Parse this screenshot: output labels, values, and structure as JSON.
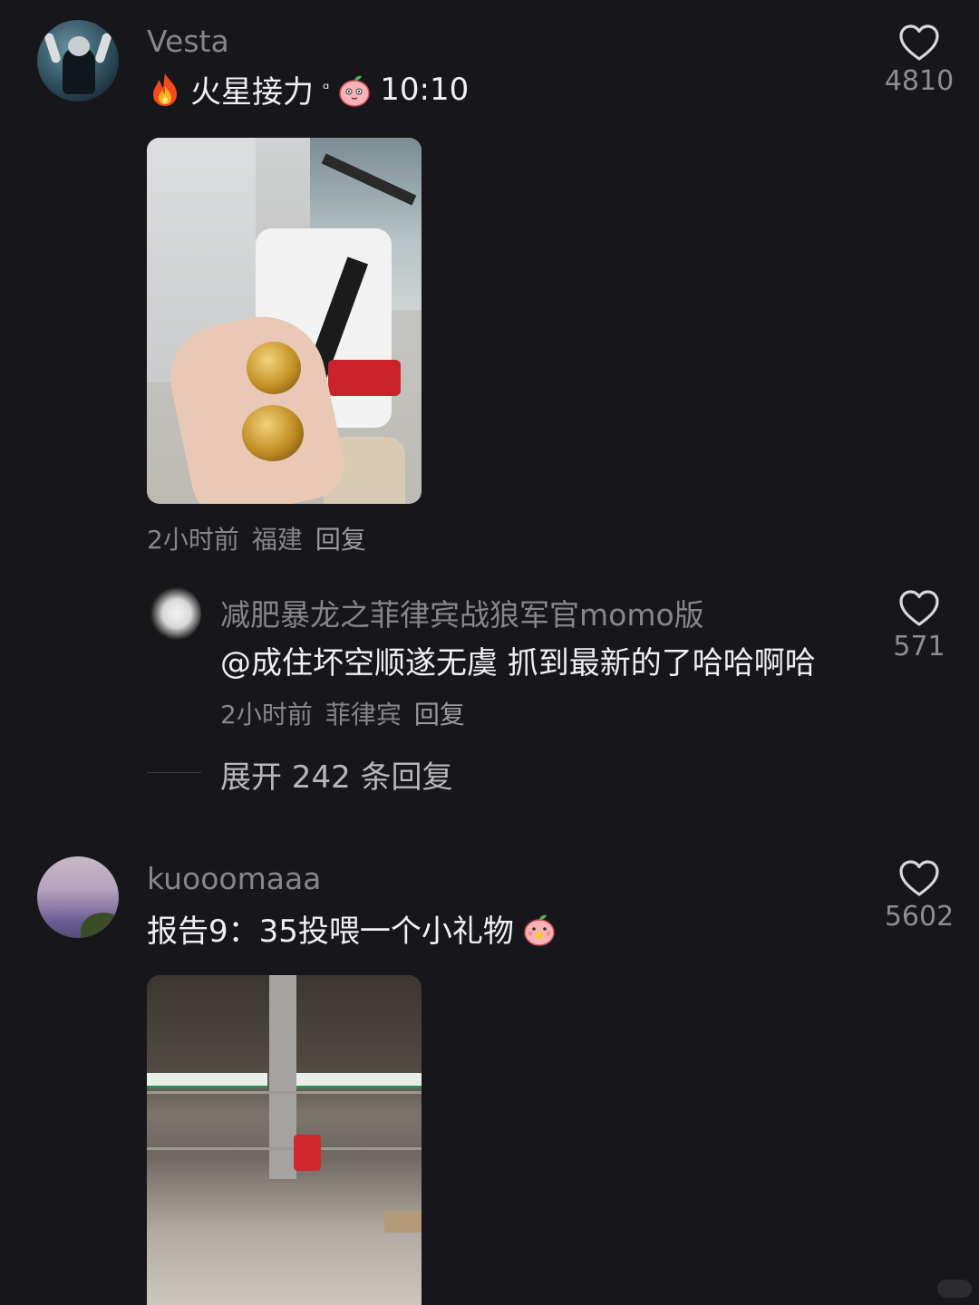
{
  "comments": [
    {
      "username": "Vesta",
      "text": "火星接力",
      "text_superscript": "ᵅ",
      "text_suffix": "10:10",
      "likes": "4810",
      "time": "2小时前",
      "location": "福建",
      "reply_label": "回复",
      "icons": [
        "fire-emoji-icon",
        "peach-face-emoji-icon"
      ],
      "replies": [
        {
          "username": "减肥暴龙之菲律宾战狼军官momo版",
          "text": "@成住坏空顺遂无虞 抓到最新的了哈哈啊哈",
          "likes": "571",
          "time": "2小时前",
          "location": "菲律宾",
          "reply_label": "回复"
        }
      ],
      "expand_label": "展开 242 条回复"
    },
    {
      "username": "kuooomaaa",
      "text": "报告9：35投喂一个小礼物",
      "likes": "5602",
      "icons": [
        "peach-hug-emoji-icon"
      ]
    }
  ],
  "colors": {
    "background": "#17171b",
    "username": "#85858c",
    "text": "#f0f0f2",
    "meta": "#85858c"
  }
}
